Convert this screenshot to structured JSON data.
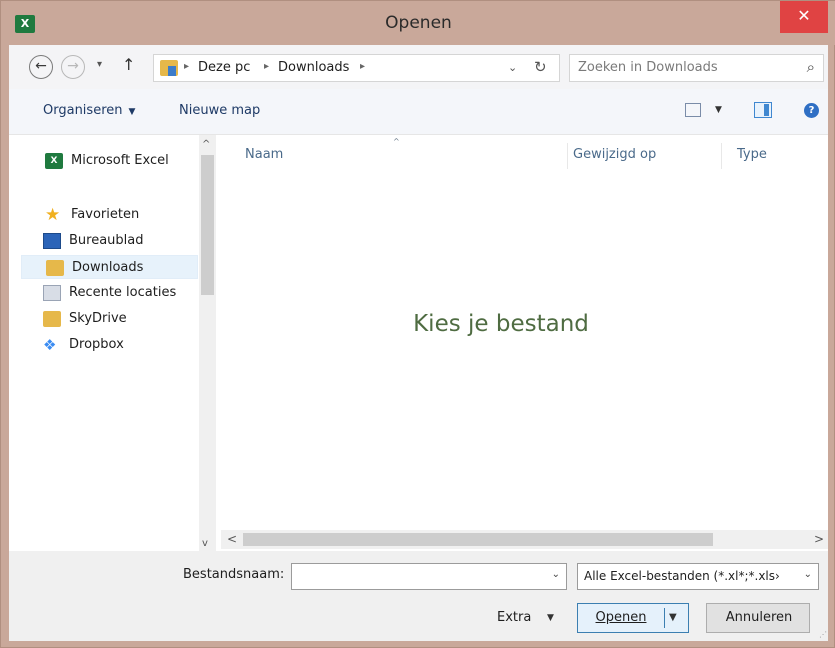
{
  "window": {
    "title": "Openen",
    "close_glyph": "✕",
    "app_icon_text": "X"
  },
  "address_bar": {
    "back_glyph": "←",
    "forward_glyph": "→",
    "recent_glyph": "▾",
    "up_glyph": "↑",
    "crumbs": [
      "Deze pc",
      "Downloads"
    ],
    "separator": "▸",
    "dropdown_glyph": "⌄",
    "refresh_glyph": "↻"
  },
  "search": {
    "placeholder": "Zoeken in Downloads",
    "icon_glyph": "⌕"
  },
  "toolbar": {
    "organize_label": "Organiseren",
    "organize_dd": "▼",
    "new_folder_label": "Nieuwe map",
    "view_dd": "▼",
    "help_glyph": "?"
  },
  "nav_pane": {
    "items": [
      {
        "label": "Microsoft Excel",
        "icon": "excel-icon",
        "icon_text": "X"
      },
      {
        "label": "Favorieten",
        "icon": "star-icon",
        "icon_text": "★"
      },
      {
        "label": "Bureaublad",
        "icon": "desktop-icon"
      },
      {
        "label": "Downloads",
        "icon": "downloads-folder-icon",
        "selected": true
      },
      {
        "label": "Recente locaties",
        "icon": "recent-places-icon"
      },
      {
        "label": "SkyDrive",
        "icon": "skydrive-icon"
      },
      {
        "label": "Dropbox",
        "icon": "dropbox-icon",
        "icon_text": "❖"
      }
    ],
    "scroll_up_glyph": "^",
    "scroll_down_glyph": "v"
  },
  "file_list": {
    "columns": [
      "Naam",
      "Gewijzigd op",
      "Type"
    ],
    "sort_glyph": "^",
    "empty_message": "Kies je bestand"
  },
  "hscroll": {
    "left_glyph": "<",
    "right_glyph": ">"
  },
  "bottom": {
    "filename_label": "Bestandsnaam:",
    "filename_value": "",
    "filename_dd": "⌄",
    "filter_value": "Alle Excel-bestanden (*.xl*;*.xls›",
    "filter_dd": "⌄",
    "extra_label": "Extra",
    "extra_dd": "▼",
    "open_label": "Openen",
    "open_dd": "▼",
    "cancel_label": "Annuleren",
    "grip_glyph": "⋰"
  },
  "colors": {
    "titlebar": "#c9a89a",
    "close": "#e04343",
    "empty_message": "#4f6c42",
    "selection": "#e7f2fb"
  }
}
